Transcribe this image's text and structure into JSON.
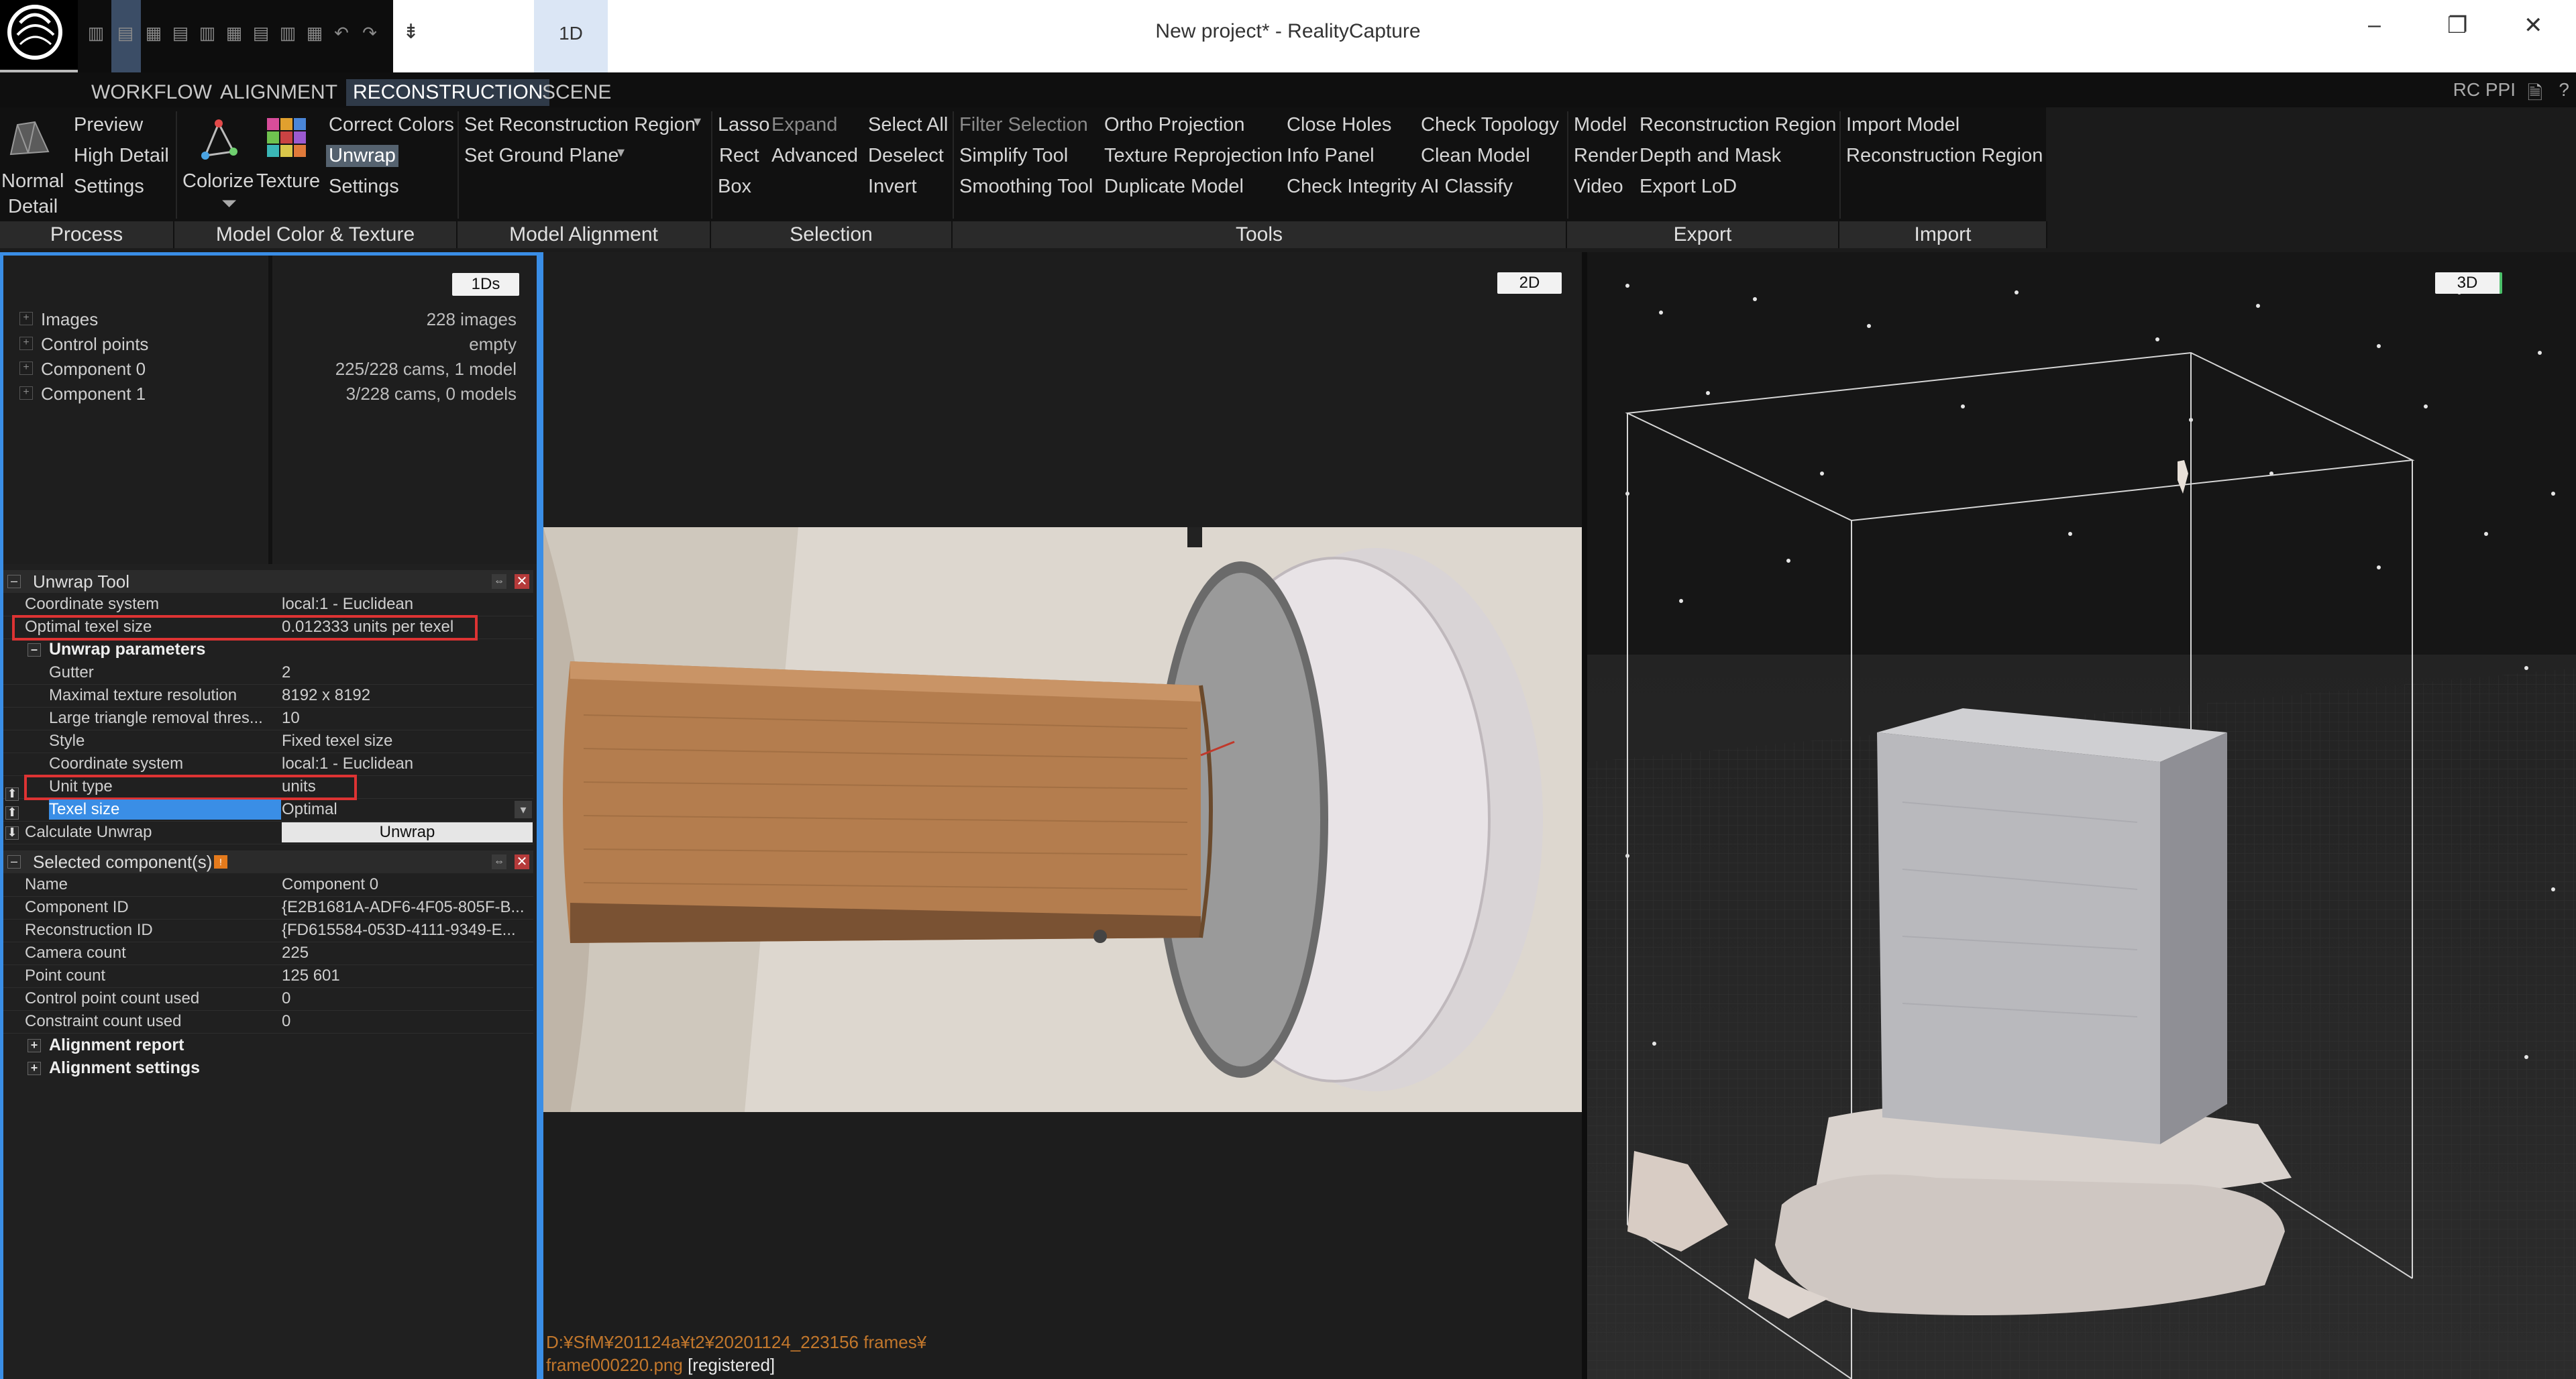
{
  "window": {
    "title": "New project* - RealityCapture",
    "layout_tab": "1D",
    "minimize": "–",
    "restore": "❐",
    "close": "✕"
  },
  "menu": {
    "tabs": [
      "WORKFLOW",
      "ALIGNMENT",
      "RECONSTRUCTION",
      "SCENE"
    ],
    "active": "RECONSTRUCTION",
    "right_label": "RC PPI"
  },
  "ribbon": {
    "process": {
      "normal_detail_1": "Normal",
      "normal_detail_2": "Detail",
      "preview": "Preview",
      "high_detail": "High Detail",
      "settings": "Settings"
    },
    "color_texture": {
      "colorize": "Colorize",
      "texture": "Texture",
      "correct_colors": "Correct Colors",
      "unwrap": "Unwrap",
      "settings": "Settings"
    },
    "alignment": {
      "set_region": "Set Reconstruction Region",
      "set_ground": "Set Ground Plane"
    },
    "selection": {
      "lasso": "Lasso",
      "rect": "Rect",
      "box": "Box",
      "expand": "Expand",
      "advanced": "Advanced",
      "select_all": "Select All",
      "deselect": "Deselect",
      "invert": "Invert"
    },
    "tools": {
      "filter_selection": "Filter Selection",
      "simplify": "Simplify Tool",
      "smoothing": "Smoothing Tool",
      "ortho": "Ortho Projection",
      "texture_reprojection": "Texture Reprojection",
      "duplicate": "Duplicate Model",
      "close_holes": "Close Holes",
      "info_panel": "Info Panel",
      "check_integrity": "Check Integrity",
      "check_topology": "Check Topology",
      "clean_model": "Clean Model",
      "ai_classify": "AI Classify"
    },
    "export": {
      "model": "Model",
      "render": "Render",
      "video": "Video",
      "reconstruction_region": "Reconstruction Region",
      "depth_mask": "Depth and Mask",
      "export_lod": "Export LoD"
    },
    "import": {
      "import_model": "Import Model",
      "reconstruction_region": "Reconstruction Region"
    },
    "groups": [
      "Process",
      "Model Color & Texture",
      "Model Alignment",
      "Selection",
      "Tools",
      "Export",
      "Import"
    ]
  },
  "tree": {
    "badge": "1Ds",
    "items": [
      {
        "label": "Images",
        "value": "228 images"
      },
      {
        "label": "Control points",
        "value": "empty"
      },
      {
        "label": "Component 0",
        "value": "225/228 cams, 1 model"
      },
      {
        "label": "Component 1",
        "value": "3/228 cams, 0 models"
      }
    ]
  },
  "unwrap_tool": {
    "title": "Unwrap Tool",
    "coordinate_system": {
      "k": "Coordinate system",
      "v": "local:1 - Euclidean"
    },
    "optimal_texel": {
      "k": "Optimal texel size",
      "v": "0.012333 units per texel"
    },
    "params_title": "Unwrap parameters",
    "params": [
      {
        "k": "Gutter",
        "v": "2"
      },
      {
        "k": "Maximal texture resolution",
        "v": "8192 x 8192"
      },
      {
        "k": "Large triangle removal thres...",
        "v": "10"
      },
      {
        "k": "Style",
        "v": "Fixed texel size"
      },
      {
        "k": "Coordinate system",
        "v": "local:1 - Euclidean"
      },
      {
        "k": "Unit type",
        "v": "units"
      },
      {
        "k": "Texel size",
        "v": "Optimal"
      }
    ],
    "calculate": {
      "k": "Calculate Unwrap",
      "v": "Unwrap"
    }
  },
  "selected": {
    "title": "Selected component(s)",
    "rows": [
      {
        "k": "Name",
        "v": "Component 0"
      },
      {
        "k": "Component ID",
        "v": "{E2B1681A-ADF6-4F05-805F-B..."
      },
      {
        "k": "Reconstruction ID",
        "v": "{FD615584-053D-4111-9349-E..."
      },
      {
        "k": "Camera count",
        "v": "225"
      },
      {
        "k": "Point count",
        "v": "125 601"
      },
      {
        "k": "Control point count used",
        "v": "0"
      },
      {
        "k": "Constraint count used",
        "v": "0"
      }
    ],
    "alignment_report": "Alignment report",
    "alignment_settings": "Alignment settings"
  },
  "view2d": {
    "badge": "2D",
    "path_line1": "D:¥SfM¥201124a¥t2¥20201124_223156 frames¥",
    "path_line2": "frame000220.png",
    "status": "[registered]"
  },
  "view3d": {
    "badge": "3D"
  }
}
